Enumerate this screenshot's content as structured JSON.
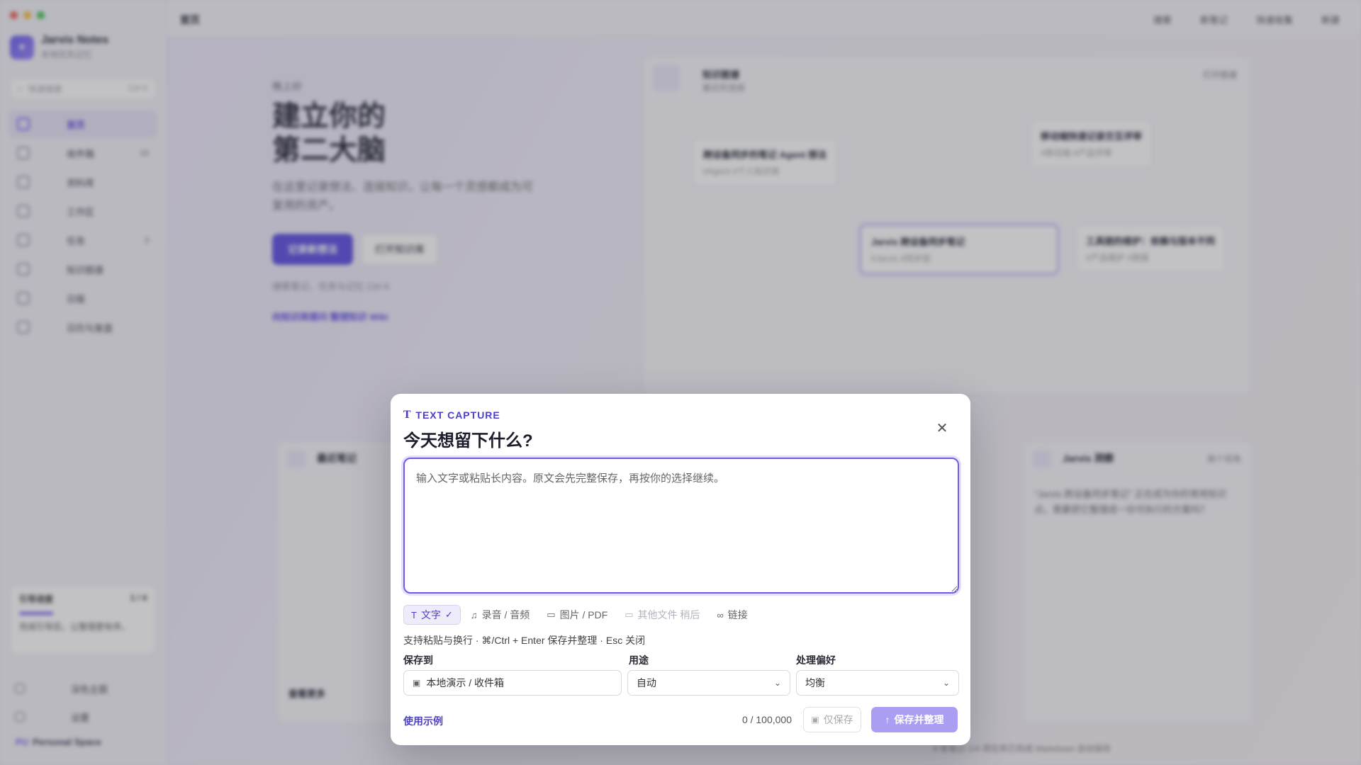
{
  "background": {
    "brand": {
      "name": "Jarvis Notes",
      "subtitle": "本地优先记忆"
    },
    "search": {
      "placeholder": "快速搜索",
      "shortcut": "Ctrl K"
    },
    "nav": [
      {
        "label": "首页",
        "active": true,
        "badge": ""
      },
      {
        "label": "收件箱",
        "active": false,
        "badge": "16"
      },
      {
        "label": "资料库",
        "active": false,
        "badge": ""
      },
      {
        "label": "工作区",
        "active": false,
        "badge": ""
      },
      {
        "label": "任务",
        "active": false,
        "badge": "3"
      },
      {
        "label": "知识图谱",
        "active": false,
        "badge": ""
      },
      {
        "label": "日报",
        "active": false,
        "badge": ""
      },
      {
        "label": "日历与复盘",
        "active": false,
        "badge": ""
      }
    ],
    "progress": {
      "title": "引导进度",
      "count": "1 / 4",
      "text": "完成引导后，让整理更有序。"
    },
    "side_bottom": [
      "深色主题",
      "设置"
    ],
    "space": {
      "badge": "PU",
      "label": "Personal Space"
    },
    "topbar": {
      "crumb": "首页",
      "actions": [
        "搜索",
        "新笔记",
        "快速收集",
        "新建"
      ]
    },
    "hero": {
      "greet": "晚上好",
      "title_line1": "建立你的",
      "title_line2": "第二大脑",
      "desc": "在这里记录想法、连接知识，让每一个灵感都成为可复用的资产。",
      "primary_button": "记录新想法",
      "secondary_button": "打开知识库",
      "hint": "搜索笔记、任务与记忆   Ctrl K",
      "links": "向知识库提问   整理知识 Wiki"
    },
    "graph": {
      "title": "知识图谱",
      "subtitle": "最近的连接",
      "open": "打开图谱",
      "nodes": [
        {
          "title": "跨设备同步的笔记 Agent 想法",
          "tags": "#Agent #个人知识库"
        },
        {
          "title": "移动端快速记录交互评审",
          "tags": "#移动端 #产品评审"
        },
        {
          "title": "Jarvis 跨设备同步笔记",
          "tags": "#Jarvis #同步层"
        },
        {
          "title": "工具链的维护：依赖与版本不同",
          "tags": "#产品维护 #周报"
        }
      ]
    },
    "recent": {
      "title": "最近笔记",
      "more": "查看更多"
    },
    "insight": {
      "title": "Jarvis 洞察",
      "action": "换个视角",
      "text": "\"Jarvis 跨设备同步笔记\" 正在成为你的常用知识点。需要把它整理成一份可执行的方案吗？"
    },
    "status_bar": "4 条笔记   1/4 项任务已完成   Markdown 自动保存"
  },
  "modal": {
    "kicker": "TEXT CAPTURE",
    "title": "今天想留下什么?",
    "textarea_placeholder": "输入文字或粘贴长内容。原文会先完整保存，再按你的选择继续。",
    "tabs": [
      {
        "label": "文字",
        "icon": "text-icon",
        "state": "active"
      },
      {
        "label": "录音 / 音频",
        "icon": "audio-icon",
        "state": "normal"
      },
      {
        "label": "图片 / PDF",
        "icon": "file-icon",
        "state": "normal"
      },
      {
        "label": "其他文件 稍后",
        "icon": "file-icon",
        "state": "disabled"
      },
      {
        "label": "链接",
        "icon": "link-icon",
        "state": "normal"
      }
    ],
    "hint": "支持粘贴与换行 · ⌘/Ctrl + Enter 保存并整理 · Esc 关闭",
    "save_to": {
      "label": "保存到",
      "value": "本地演示 / 收件箱"
    },
    "purpose": {
      "label": "用途",
      "value": "自动"
    },
    "preference": {
      "label": "处理偏好",
      "value": "均衡"
    },
    "example_link": "使用示例",
    "char_count": "0 / 100,000",
    "save_only": "仅保存",
    "save_and_organize": "保存并整理",
    "colors": {
      "accent": "#4b3fc9",
      "primary_disabled": "#a99ef1",
      "focus_border": "#6b5cf0"
    }
  }
}
